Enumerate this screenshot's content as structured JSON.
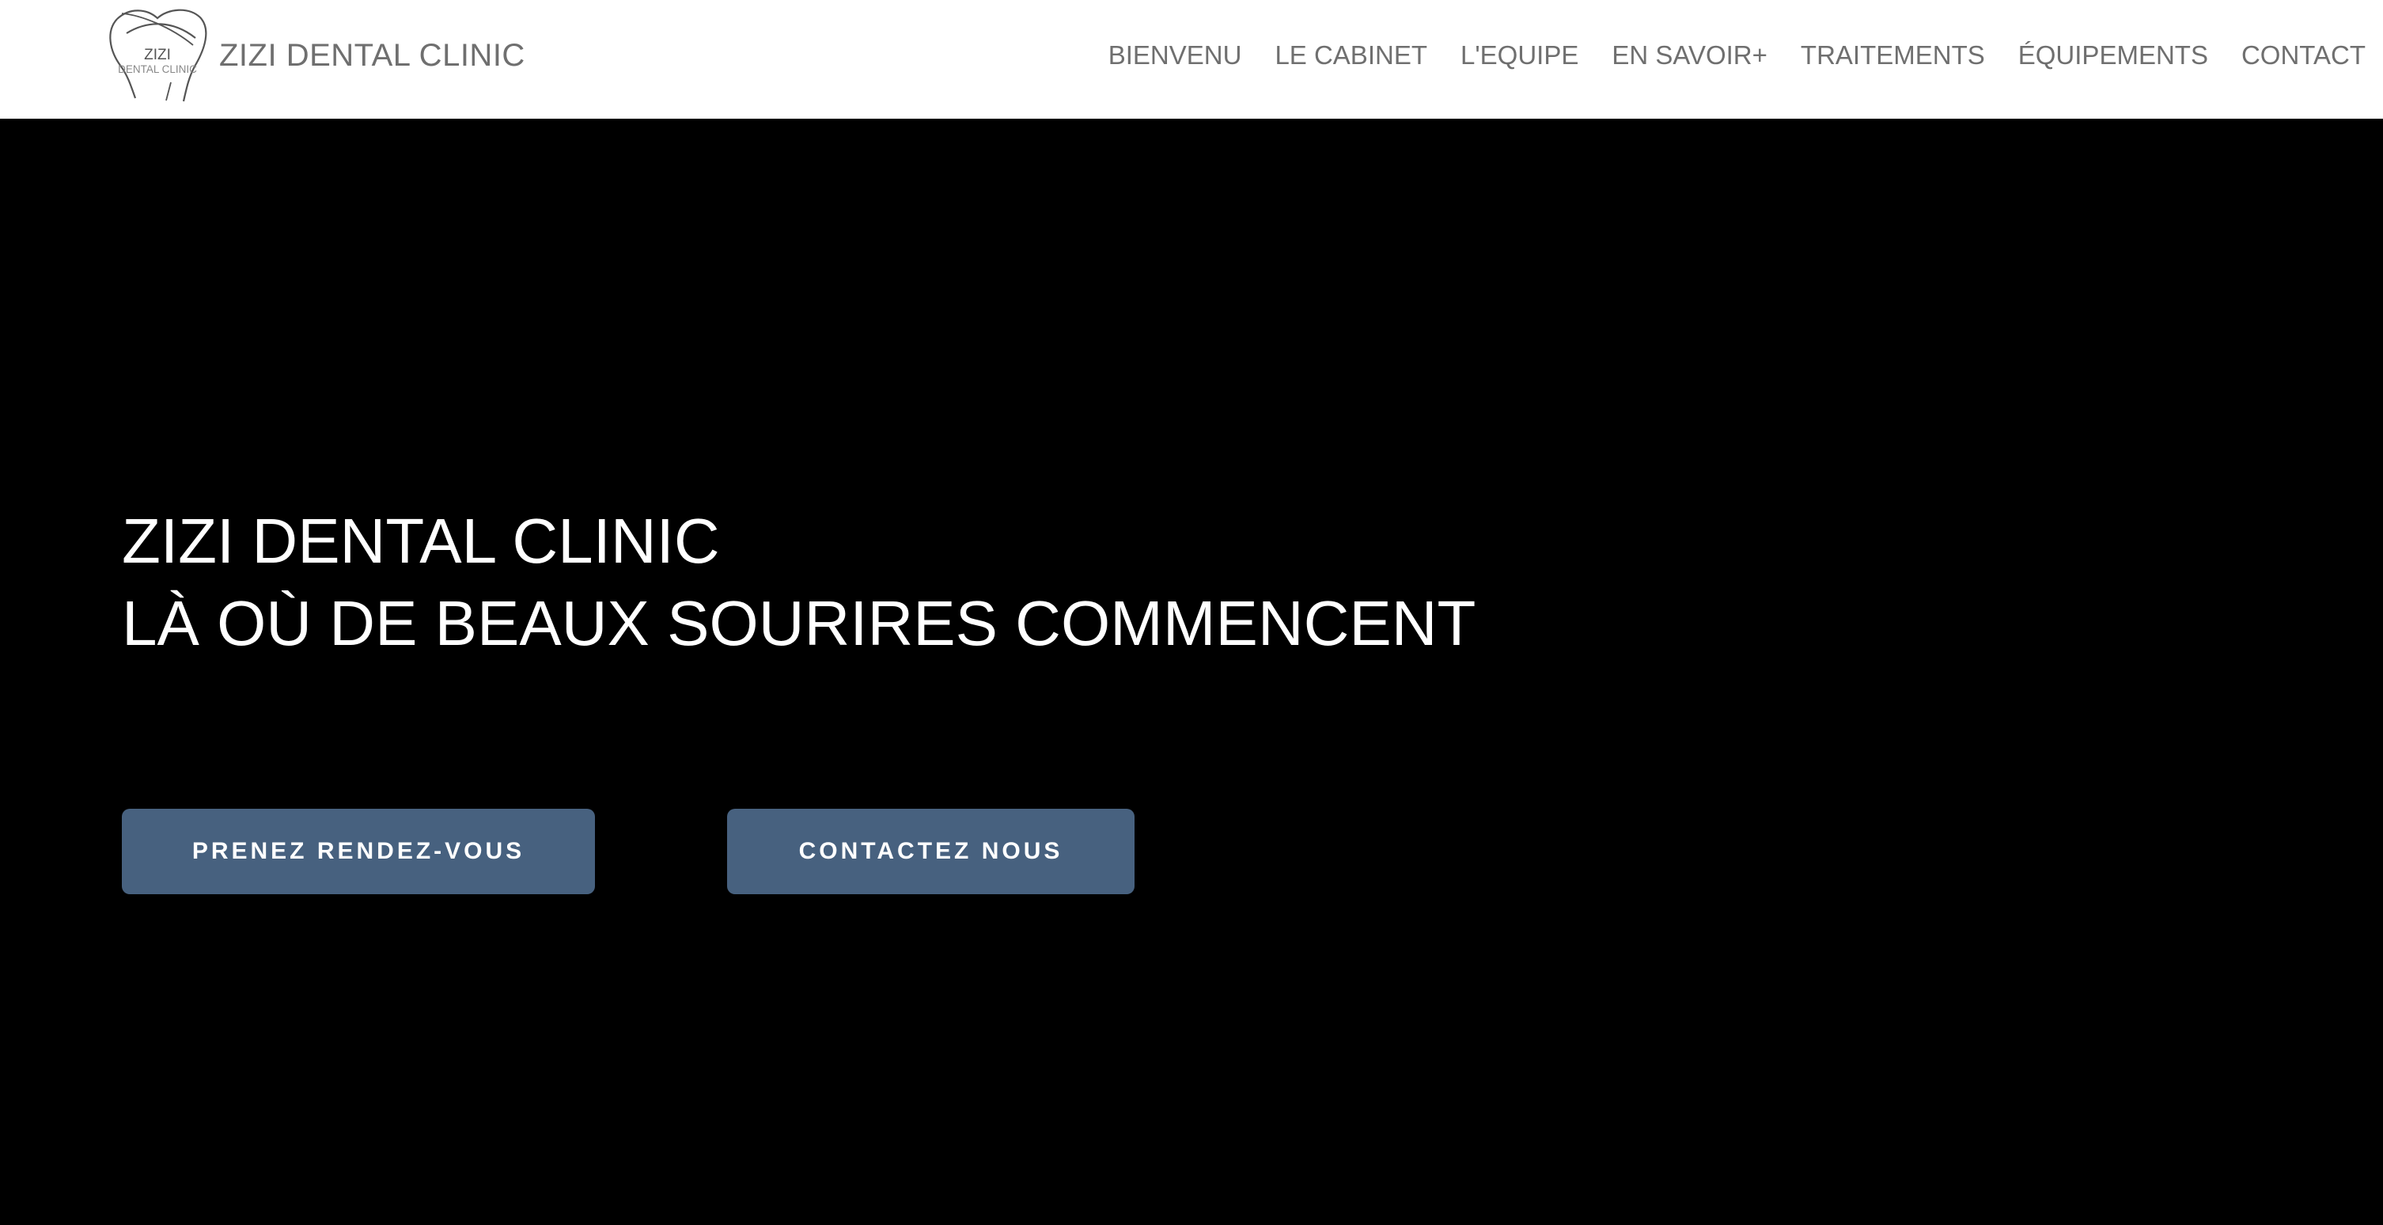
{
  "header": {
    "logo": {
      "line1": "ZIZI",
      "line2": "DENTAL CLINIC",
      "icon": "tooth-icon"
    },
    "brand": "ZIZI DENTAL CLINIC",
    "nav": [
      "BIENVENU",
      "LE CABINET",
      "L'EQUIPE",
      "EN SAVOIR+",
      "TRAITEMENTS",
      "ÉQUIPEMENTS",
      "CONTACT"
    ]
  },
  "hero": {
    "title_line1": "ZIZI DENTAL CLINIC",
    "title_line2": "LÀ OÙ DE BEAUX SOURIRES COMMENCENT",
    "buttons": {
      "appointment": "PRENEZ RENDEZ-VOUS",
      "contact": "CONTACTEZ NOUS"
    }
  },
  "colors": {
    "header_background": "#ffffff",
    "hero_background": "#000000",
    "button_background": "#47617f",
    "nav_text": "#6f6f6f",
    "hero_text": "#ffffff"
  }
}
